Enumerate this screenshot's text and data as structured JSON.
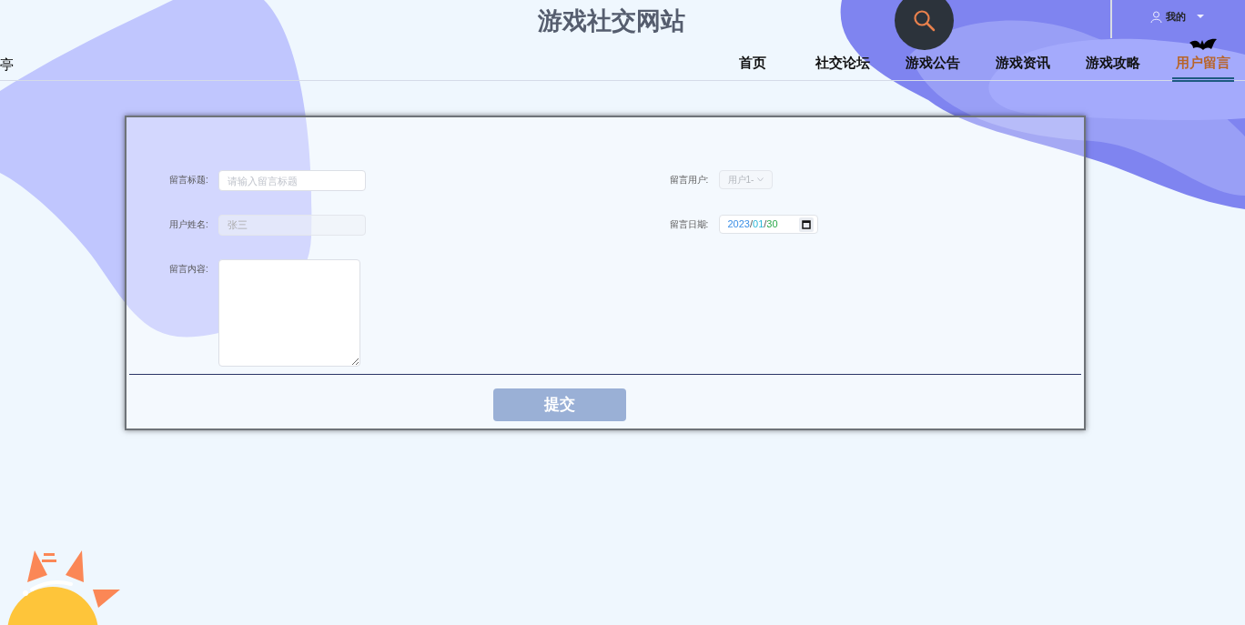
{
  "site_title": "游戏社交网站",
  "left_text": "亭",
  "user_menu": {
    "label": "我的"
  },
  "nav": [
    {
      "label": "首页",
      "selected": false
    },
    {
      "label": "社交论坛",
      "selected": false
    },
    {
      "label": "游戏公告",
      "selected": false
    },
    {
      "label": "游戏资讯",
      "selected": false
    },
    {
      "label": "游戏攻略",
      "selected": false
    },
    {
      "label": "用户留言",
      "selected": true
    }
  ],
  "form": {
    "fields": [
      {
        "kind": "text",
        "label": "留言标题:",
        "placeholder": "请输入留言标题",
        "disabled": false
      },
      {
        "kind": "select",
        "label": "留言用户:",
        "value": "用户1-",
        "disabled": true
      },
      {
        "kind": "text",
        "label": "用户姓名:",
        "value": "张三",
        "disabled": true
      },
      {
        "kind": "date",
        "label": "留言日期:",
        "value": "2023/01/30"
      },
      {
        "kind": "textarea",
        "label": "留言内容:"
      }
    ],
    "submit": "提交"
  }
}
